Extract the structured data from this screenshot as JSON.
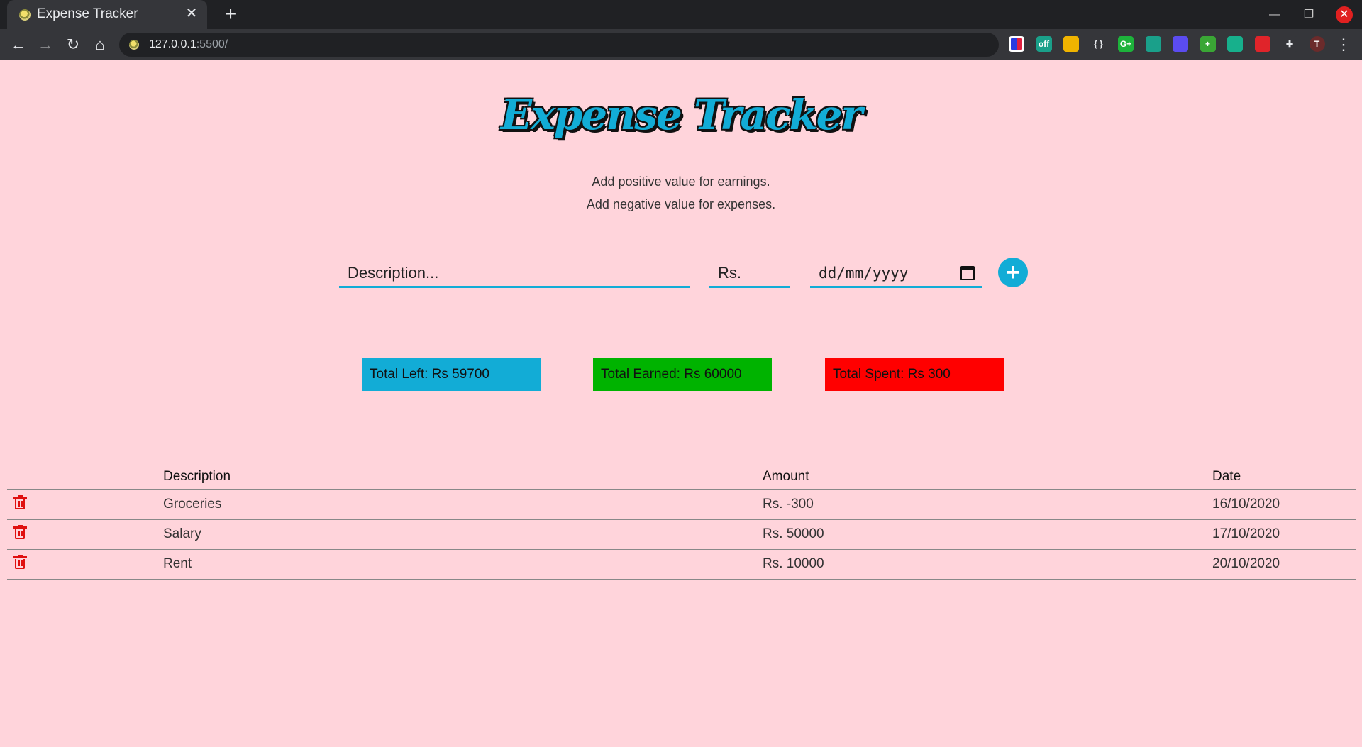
{
  "browser": {
    "tab_title": "Expense Tracker",
    "url_host": "127.0.0.1",
    "url_rest": ":5500/",
    "extensions": [
      {
        "name": "ext-1-icon",
        "text": "",
        "color": "#ffffff"
      },
      {
        "name": "ext-off-icon",
        "text": "off",
        "color": "#1aa08a"
      },
      {
        "name": "thumbs-up-icon",
        "text": "",
        "color": "#f0b400"
      },
      {
        "name": "json-braces-icon",
        "text": "{ }",
        "color": "#35363a"
      },
      {
        "name": "ext-g-icon",
        "text": "G+",
        "color": "#1db33b"
      },
      {
        "name": "ext-cycle-icon",
        "text": "",
        "color": "#1aa08a"
      },
      {
        "name": "ext-color-icon",
        "text": "",
        "color": "#5b4cf0"
      },
      {
        "name": "ext-plus-icon",
        "text": "+",
        "color": "#3aa635"
      },
      {
        "name": "ext-face-icon",
        "text": "",
        "color": "#17b08c"
      },
      {
        "name": "ext-hand-icon",
        "text": "",
        "color": "#e0242a"
      },
      {
        "name": "puzzle-icon",
        "text": "",
        "color": "#35363a"
      },
      {
        "name": "profile-avatar",
        "text": "T",
        "color": "#6b2b2b"
      }
    ]
  },
  "app": {
    "logo": "Expense Tracker",
    "hint_1": "Add positive value for earnings.",
    "hint_2": "Add negative value for expenses.",
    "inputs": {
      "description_placeholder": "Description...",
      "amount_placeholder": "Rs.",
      "date_placeholder": "dd/mm/yyyy"
    },
    "summary": {
      "left_label": "Total Left:  Rs  59700",
      "earned_label": "Total Earned:  Rs  60000",
      "spent_label": "Total Spent:  Rs  300",
      "left_color": "#12acd6",
      "earned_color": "#00b300",
      "spent_color": "#ff0000"
    },
    "table": {
      "headers": [
        "",
        "Description",
        "Amount",
        "Date"
      ],
      "rows": [
        {
          "description": "Groceries",
          "amount": "Rs. -300",
          "date": "16/10/2020"
        },
        {
          "description": "Salary",
          "amount": "Rs. 50000",
          "date": "17/10/2020"
        },
        {
          "description": "Rent",
          "amount": "Rs. 10000",
          "date": "20/10/2020"
        }
      ]
    }
  }
}
